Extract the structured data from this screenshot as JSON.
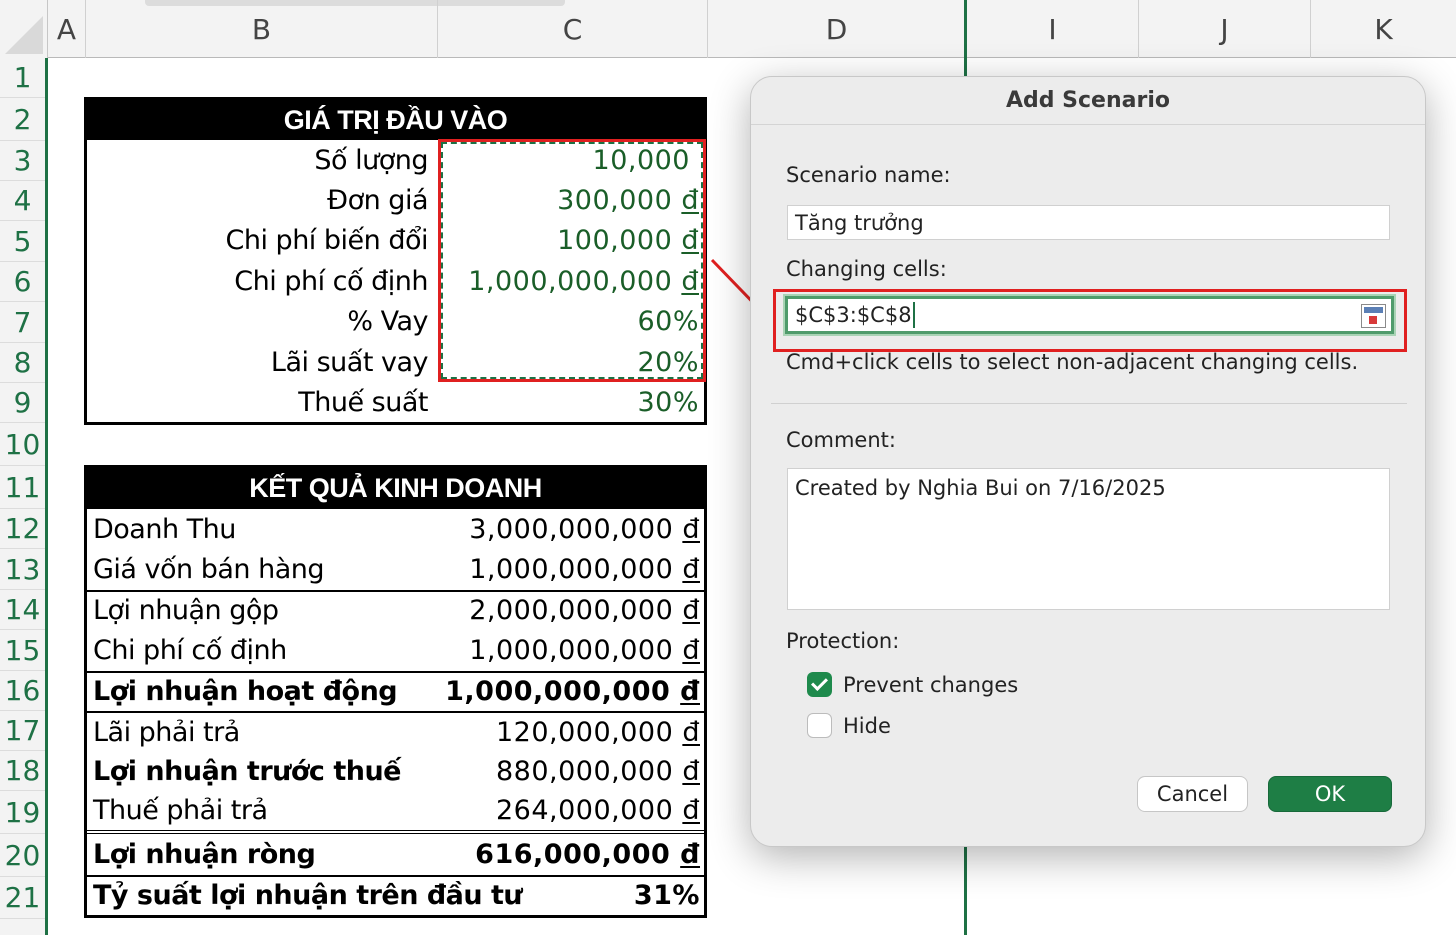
{
  "columns": [
    "A",
    "B",
    "C",
    "D",
    "I",
    "J",
    "K"
  ],
  "rows": [
    "1",
    "2",
    "3",
    "4",
    "5",
    "6",
    "7",
    "8",
    "9",
    "10",
    "11",
    "12",
    "13",
    "14",
    "15",
    "16",
    "17",
    "18",
    "19",
    "20",
    "21"
  ],
  "input_table": {
    "title": "GIÁ TRỊ ĐẦU VÀO",
    "rows": [
      {
        "label": "Số lượng",
        "value": "10,000",
        "unit": ""
      },
      {
        "label": "Đơn giá",
        "value": "300,000",
        "unit": "đ"
      },
      {
        "label": "Chi phí biến đổi",
        "value": "100,000",
        "unit": "đ"
      },
      {
        "label": "Chi phí cố định",
        "value": "1,000,000,000",
        "unit": "đ"
      },
      {
        "label": "% Vay",
        "value": "60%",
        "unit": ""
      },
      {
        "label": "Lãi suất vay",
        "value": "20%",
        "unit": ""
      },
      {
        "label": "Thuế suất",
        "value": "30%",
        "unit": ""
      }
    ]
  },
  "result_table": {
    "title": "KẾT QUẢ KINH DOANH",
    "rows": [
      {
        "label": "Doanh Thu",
        "value": "3,000,000,000",
        "unit": "đ"
      },
      {
        "label": "Giá vốn bán hàng",
        "value": "1,000,000,000",
        "unit": "đ"
      },
      {
        "label": "Lợi nhuận gộp",
        "value": "2,000,000,000",
        "unit": "đ"
      },
      {
        "label": "Chi phí cố định",
        "value": "1,000,000,000",
        "unit": "đ"
      },
      {
        "label": "Lợi nhuận hoạt động",
        "value": "1,000,000,000",
        "unit": "đ"
      },
      {
        "label": "Lãi phải trả",
        "value": "120,000,000",
        "unit": "đ"
      },
      {
        "label": "Lợi nhuận trước thuế",
        "value": "880,000,000",
        "unit": "đ"
      },
      {
        "label": "Thuế phải trả",
        "value": "264,000,000",
        "unit": "đ"
      },
      {
        "label": "Lợi nhuận ròng",
        "value": "616,000,000",
        "unit": "đ"
      },
      {
        "label": "Tỷ suất lợi nhuận trên đầu tư",
        "value": "31%",
        "unit": ""
      }
    ]
  },
  "dialog": {
    "title": "Add Scenario",
    "scenario_name_label": "Scenario name:",
    "scenario_name_value": "Tăng trưởng",
    "changing_cells_label": "Changing cells:",
    "changing_cells_value": "$C$3:$C$8",
    "hint": "Cmd+click cells to select non-adjacent changing cells.",
    "comment_label": "Comment:",
    "comment_value": "Created by Nghia Bui on 7/16/2025",
    "protection_label": "Protection:",
    "prevent_changes_label": "Prevent changes",
    "prevent_changes_checked": true,
    "hide_label": "Hide",
    "hide_checked": false,
    "cancel_label": "Cancel",
    "ok_label": "OK"
  },
  "colors": {
    "accent_green": "#1e7145",
    "value_green": "#1a5e28",
    "highlight_red": "#e02020",
    "ok_button": "#1e7e45"
  }
}
